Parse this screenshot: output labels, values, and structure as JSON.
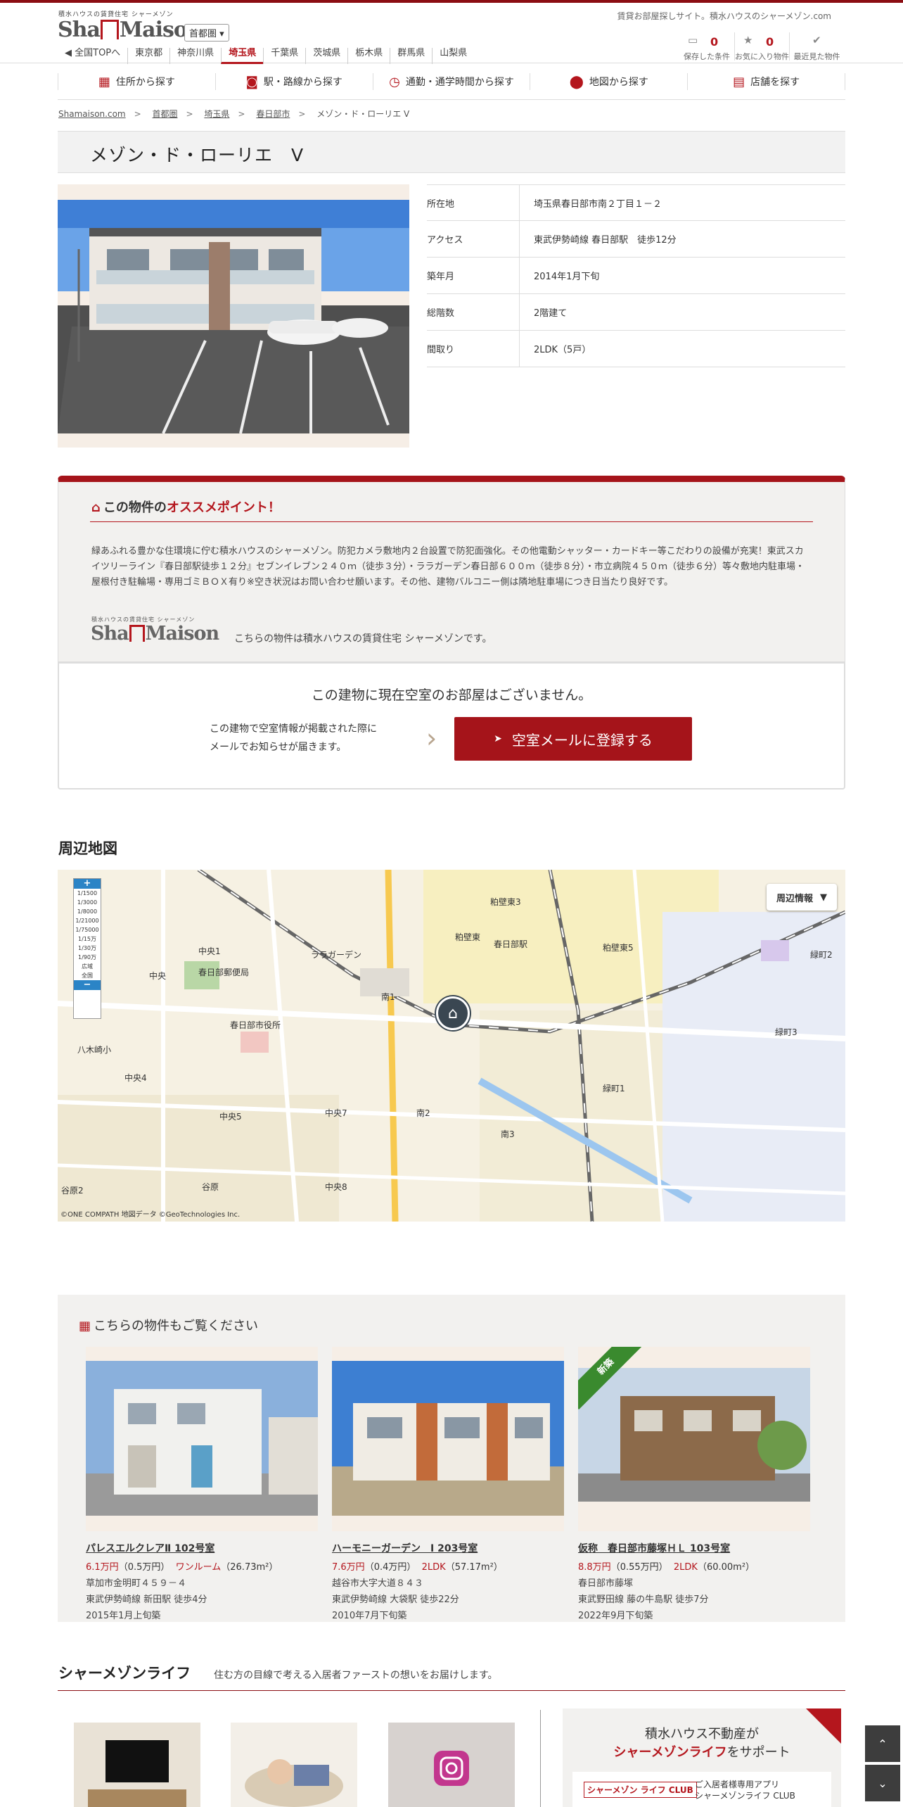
{
  "header": {
    "logo_small": "積水ハウスの賃貸住宅 シャーメゾン",
    "logo_left": "Sha",
    "logo_right": "Maison",
    "region_select": "首都圏 ▾",
    "site_desc": "賃貸お部屋探しサイト。積水ハウスのシャーメゾン.com",
    "pref_nav": [
      "◀ 全国TOPへ",
      "東京都",
      "神奈川県",
      "埼玉県",
      "千葉県",
      "茨城県",
      "栃木県",
      "群馬県",
      "山梨県"
    ],
    "icons": [
      {
        "name": "saved-conditions",
        "icon": "folder-icon",
        "count": "0",
        "label": "保存した条件"
      },
      {
        "name": "favorites",
        "icon": "star-icon",
        "count": "0",
        "label": "お気に入り物件"
      },
      {
        "name": "recent",
        "icon": "check-icon",
        "count": "",
        "label": "最近見た物件"
      }
    ]
  },
  "search_nav": [
    {
      "label": "住所から探す",
      "icon": "building-icon"
    },
    {
      "label": "駅・路線から探す",
      "icon": "train-icon"
    },
    {
      "label": "通勤・通学時間から探す",
      "icon": "clock-icon"
    },
    {
      "label": "地図から探す",
      "icon": "map-pin-icon"
    },
    {
      "label": "店舗を探す",
      "icon": "shop-icon"
    }
  ],
  "breadcrumb": [
    "Shamaison.com",
    "首都圏",
    "埼玉県",
    "春日部市",
    "メゾン・ド・ローリエ Ⅴ"
  ],
  "property": {
    "title": "メゾン・ド・ローリエ　Ⅴ",
    "info": [
      {
        "key": "所在地",
        "value": "埼玉県春日部市南２丁目１－２"
      },
      {
        "key": "アクセス",
        "value": "東武伊勢崎線 春日部駅　徒歩12分"
      },
      {
        "key": "築年月",
        "value": "2014年1月下旬"
      },
      {
        "key": "総階数",
        "value": "2階建て"
      },
      {
        "key": "間取り",
        "value": "2LDK（5戸）"
      }
    ]
  },
  "recommend": {
    "title_pre": "この物件の",
    "title_hl": "オススメポイント！",
    "text": "緑あふれる豊かな住環境に佇む積水ハウスのシャーメゾン。防犯カメラ敷地内２台設置で防犯面強化。その他電動シャッター・カードキー等こだわりの設備が充実！東武スカイツリーライン『春日部駅徒歩１２分』セブンイレブン２４０ｍ（徒歩３分）・ララガーデン春日部６００ｍ（徒歩８分）・市立病院４５０ｍ（徒歩６分）等々敷地内駐車場・屋根付き駐輪場・専用ゴミＢＯＸ有り※空き状況はお問い合わせ願います。その他、建物バルコニー側は隣地駐車場につき日当たり良好です。",
    "logo_small": "積水ハウスの賃貸住宅 シャーメゾン",
    "logo_note": "こちらの物件は積水ハウスの賃貸住宅 シャーメゾンです。"
  },
  "vacancy": {
    "title": "この建物に現在空室のお部屋はございません。",
    "note_line1": "この建物で空室情報が掲載された際に",
    "note_line2": "メールでお知らせが届きます。",
    "button": "空室メールに登録する"
  },
  "map": {
    "title": "周辺地図",
    "info_button": "周辺情報",
    "copyright": "©ONE COMPATH 地図データ ©GeoTechnologies Inc.",
    "zoom_levels": [
      "1/1500",
      "1/3000",
      "1/8000",
      "1/21000",
      "1/75000",
      "1/15万",
      "1/30万",
      "1/90万",
      "広域",
      "全国"
    ],
    "labels": [
      "春日部駅",
      "南1",
      "南2",
      "南3",
      "中央1",
      "中央",
      "中央4",
      "中央5",
      "中央7",
      "中央8",
      "粕壁東3",
      "粕壁東",
      "粕壁東5",
      "緑町1",
      "緑町2",
      "緑町3",
      "八木崎小",
      "谷原",
      "谷原2",
      "春日部市役所",
      "ララガーデン",
      "春日部郵便局"
    ]
  },
  "related": {
    "title": "こちらの物件もご覧ください",
    "items": [
      {
        "name": "パレスエルクレアⅡ 102号室",
        "rent": "6.1万円",
        "fee": "（0.5万円）",
        "layout": "ワンルーム",
        "area": "（26.73m²）",
        "address": "草加市金明町４５９－４",
        "access": "東武伊勢崎線 新田駅 徒歩4分",
        "built": "2015年1月上旬築",
        "new": ""
      },
      {
        "name": "ハーモニーガーデン　Ⅰ 203号室",
        "rent": "7.6万円",
        "fee": "（0.4万円）",
        "layout": "2LDK",
        "area": "（57.17m²）",
        "address": "越谷市大字大道８４３",
        "access": "東武伊勢崎線 大袋駅 徒歩22分",
        "built": "2010年7月下旬築",
        "new": ""
      },
      {
        "name": "仮称　春日部市藤塚ＨＬ 103号室",
        "rent": "8.8万円",
        "fee": "（0.55万円）",
        "layout": "2LDK",
        "area": "（60.00m²）",
        "address": "春日部市藤塚",
        "access": "東武野田線 藤の牛島駅 徒歩7分",
        "built": "2022年9月下旬築",
        "new": "新築"
      }
    ]
  },
  "life": {
    "title": "シャーメゾンライフ",
    "sub": "住む方の目線で考える入居者ファーストの想いをお届けします。",
    "promo_line1": "積水ハウス不動産が",
    "promo_hl": "シャーメゾンライフ",
    "promo_rest": "をサポート",
    "app_logo": "シャーメゾン ライフ CLUB",
    "app_text1": "ご入居者様専用アプリ",
    "app_text2": "シャーメゾンライフ CLUB"
  },
  "colors": {
    "brand": "#a5141a",
    "accent": "#b4161d"
  }
}
